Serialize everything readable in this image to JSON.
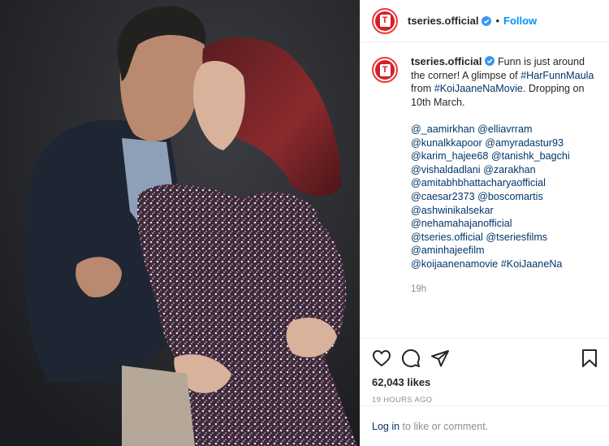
{
  "post": {
    "photo_icon": "couple-photo",
    "header": {
      "username": "tseries.official",
      "verified_icon": "verified-badge-icon",
      "separator": "•",
      "follow_label": "Follow",
      "avatar_letter": "T"
    },
    "caption": {
      "username": "tseries.official",
      "text_before": "Funn is just around the corner! A glimpse of",
      "hashtag1": "#HarFunnMaula",
      "text_mid": "from",
      "hashtag2": "#KoiJaaneNaMovie",
      "text_after": ". Dropping on 10th March.",
      "tag_lines": [
        "@_aamirkhan @elliavrram",
        "@kunalkkapoor @amyradastur93",
        "@karim_hajee68 @tanishk_bagchi",
        "@vishaldadlani @zarakhan",
        "@amitabhbhattacharyaofficial",
        "@caesar2373 @boscomartis",
        "@ashwinikalsekar",
        "@nehamahajanofficial",
        "@tseries.official @tseriesfilms",
        "@aminhajeefilm",
        "@koijaanenamovie #KoiJaaneNa"
      ],
      "time": "19h"
    },
    "actions": {
      "icons": [
        "heart-icon",
        "comment-icon",
        "share-icon",
        "bookmark-icon"
      ],
      "likes": "62,043 likes",
      "posted_ago": "19 HOURS AGO"
    },
    "login": {
      "link_label": "Log in",
      "suffix": "to like or comment."
    }
  }
}
